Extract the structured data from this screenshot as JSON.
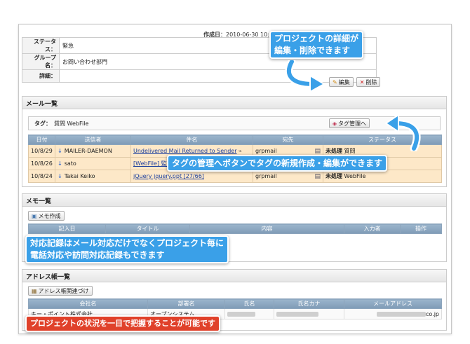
{
  "project": {
    "created_label": "作成日",
    "created_value": "：2010-06-30 10:",
    "fields": [
      {
        "label": "ステータス：",
        "value": "緊急"
      },
      {
        "label": "グループ名：",
        "value": "お問い合わせ部門"
      },
      {
        "label": "詳細：",
        "value": ""
      }
    ],
    "edit_label": "編集",
    "delete_label": "削除"
  },
  "mail": {
    "title": "メール一覧",
    "tag_label": "タグ：",
    "tag_value": "質問 WebFile",
    "tag_manage_label": "タグ管理へ",
    "columns": [
      "日付",
      "送信者",
      "件名",
      "宛先",
      "ステータス"
    ],
    "rows": [
      {
        "date": "10/8/29",
        "sender": "MAILER-DAEMON",
        "subject": "Undelivered Mail Returned to Sender",
        "to": "grpmail",
        "status": "未処理",
        "tag": "質問"
      },
      {
        "date": "10/8/26",
        "sender": "sato",
        "subject": "[WebFile] 監視",
        "to": "",
        "status": "",
        "tag": ""
      },
      {
        "date": "10/8/24",
        "sender": "Takai Keiko",
        "subject": "jQuery jquery.ppt [27/66]",
        "to": "grpmail",
        "status": "未処理",
        "tag": "WebFile"
      }
    ]
  },
  "memo": {
    "title": "メモ一覧",
    "create_label": "メモ作成",
    "columns": [
      "記入日",
      "タイトル",
      "内容",
      "入力者",
      "操作"
    ]
  },
  "address": {
    "title": "アドレス帳一覧",
    "link_label": "アドレス帳関連づけ",
    "columns": [
      "会社名",
      "部署名",
      "氏名",
      "氏名カナ",
      "メールアドレス"
    ],
    "row": {
      "company": "キー・ポイント株式会社",
      "dept": "オープンシステム",
      "email_suffix": "co.jp"
    }
  },
  "callouts": {
    "top": [
      "プロジェクトの詳細が",
      "編集・削除できます"
    ],
    "tag": "タグの管理へボタンでタグの新規作成・編集ができます",
    "memo": [
      "対応記録はメール対応だけでなくプロジェクト毎に",
      "電話対応や訪問対応記録もできます"
    ],
    "bottom": "プロジェクトの状況を一目で把握することが可能です"
  },
  "colors": {
    "callout_blue": "#3aa0e8",
    "callout_red": "#e0412a",
    "row_highlight": "#fde8c8",
    "header_blue": "#8aa5bf"
  }
}
